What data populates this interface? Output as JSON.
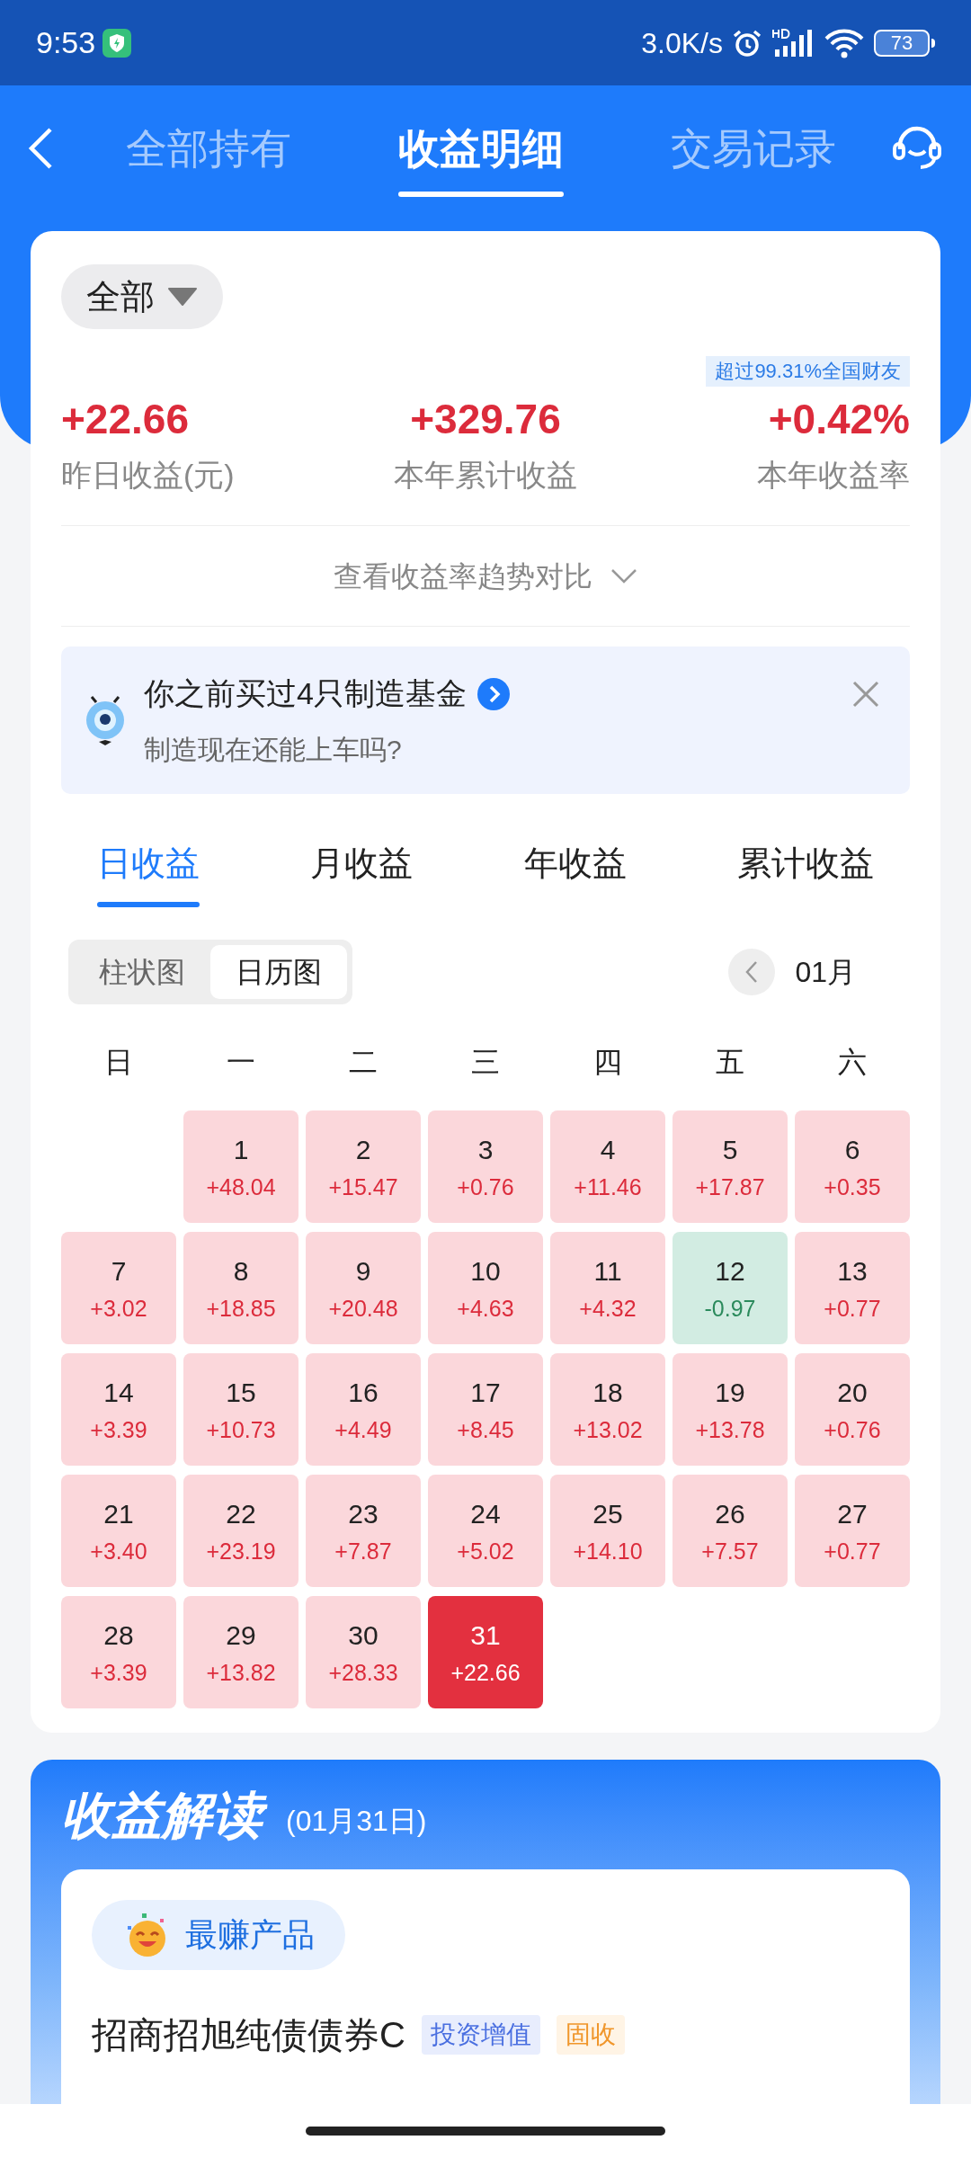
{
  "status_bar": {
    "time": "9:53",
    "speed": "3.0K/s",
    "battery": "73"
  },
  "header_tabs": [
    {
      "label": "全部持有",
      "selected": false
    },
    {
      "label": "收益明细",
      "selected": true
    },
    {
      "label": "交易记录",
      "selected": false
    }
  ],
  "filter": {
    "label": "全部"
  },
  "rank_badge": "超过99.31%全国财友",
  "summary": [
    {
      "value": "+22.66",
      "label": "昨日收益(元)"
    },
    {
      "value": "+329.76",
      "label": "本年累计收益"
    },
    {
      "value": "+0.42%",
      "label": "本年收益率"
    }
  ],
  "trend_link": "查看收益率趋势对比",
  "banner": {
    "title": "你之前买过4只制造基金",
    "subtitle": "制造现在还能上车吗?"
  },
  "period_tabs": [
    {
      "label": "日收益",
      "selected": true
    },
    {
      "label": "月收益",
      "selected": false
    },
    {
      "label": "年收益",
      "selected": false
    },
    {
      "label": "累计收益",
      "selected": false
    }
  ],
  "view_toggle": [
    {
      "label": "柱状图",
      "selected": false
    },
    {
      "label": "日历图",
      "selected": true
    }
  ],
  "month": "01月",
  "weekdays": [
    "日",
    "一",
    "二",
    "三",
    "四",
    "五",
    "六"
  ],
  "weeks": [
    [
      {
        "kind": "blank"
      },
      {
        "day": "1",
        "amount": "+48.04",
        "kind": "gain",
        "selected": false
      },
      {
        "day": "2",
        "amount": "+15.47",
        "kind": "gain",
        "selected": false
      },
      {
        "day": "3",
        "amount": "+0.76",
        "kind": "gain",
        "selected": false
      },
      {
        "day": "4",
        "amount": "+11.46",
        "kind": "gain",
        "selected": false
      },
      {
        "day": "5",
        "amount": "+17.87",
        "kind": "gain",
        "selected": false
      },
      {
        "day": "6",
        "amount": "+0.35",
        "kind": "gain",
        "selected": false
      }
    ],
    [
      {
        "day": "7",
        "amount": "+3.02",
        "kind": "gain",
        "selected": false
      },
      {
        "day": "8",
        "amount": "+18.85",
        "kind": "gain",
        "selected": false
      },
      {
        "day": "9",
        "amount": "+20.48",
        "kind": "gain",
        "selected": false
      },
      {
        "day": "10",
        "amount": "+4.63",
        "kind": "gain",
        "selected": false
      },
      {
        "day": "11",
        "amount": "+4.32",
        "kind": "gain",
        "selected": false
      },
      {
        "day": "12",
        "amount": "-0.97",
        "kind": "loss",
        "selected": false
      },
      {
        "day": "13",
        "amount": "+0.77",
        "kind": "gain",
        "selected": false
      }
    ],
    [
      {
        "day": "14",
        "amount": "+3.39",
        "kind": "gain",
        "selected": false
      },
      {
        "day": "15",
        "amount": "+10.73",
        "kind": "gain",
        "selected": false
      },
      {
        "day": "16",
        "amount": "+4.49",
        "kind": "gain",
        "selected": false
      },
      {
        "day": "17",
        "amount": "+8.45",
        "kind": "gain",
        "selected": false
      },
      {
        "day": "18",
        "amount": "+13.02",
        "kind": "gain",
        "selected": false
      },
      {
        "day": "19",
        "amount": "+13.78",
        "kind": "gain",
        "selected": false
      },
      {
        "day": "20",
        "amount": "+0.76",
        "kind": "gain",
        "selected": false
      }
    ],
    [
      {
        "day": "21",
        "amount": "+3.40",
        "kind": "gain",
        "selected": false
      },
      {
        "day": "22",
        "amount": "+23.19",
        "kind": "gain",
        "selected": false
      },
      {
        "day": "23",
        "amount": "+7.87",
        "kind": "gain",
        "selected": false
      },
      {
        "day": "24",
        "amount": "+5.02",
        "kind": "gain",
        "selected": false
      },
      {
        "day": "25",
        "amount": "+14.10",
        "kind": "gain",
        "selected": false
      },
      {
        "day": "26",
        "amount": "+7.57",
        "kind": "gain",
        "selected": false
      },
      {
        "day": "27",
        "amount": "+0.77",
        "kind": "gain",
        "selected": false
      }
    ],
    [
      {
        "day": "28",
        "amount": "+3.39",
        "kind": "gain",
        "selected": false
      },
      {
        "day": "29",
        "amount": "+13.82",
        "kind": "gain",
        "selected": false
      },
      {
        "day": "30",
        "amount": "+28.33",
        "kind": "gain",
        "selected": false
      },
      {
        "day": "31",
        "amount": "+22.66",
        "kind": "gain",
        "selected": true
      }
    ]
  ],
  "insight": {
    "title": "收益解读",
    "date": "(01月31日)",
    "pill": "最赚产品",
    "product": "招商招旭纯债债券C",
    "tags": [
      {
        "label": "投资增值",
        "kind": "blue"
      },
      {
        "label": "固收",
        "kind": "orange"
      }
    ]
  }
}
